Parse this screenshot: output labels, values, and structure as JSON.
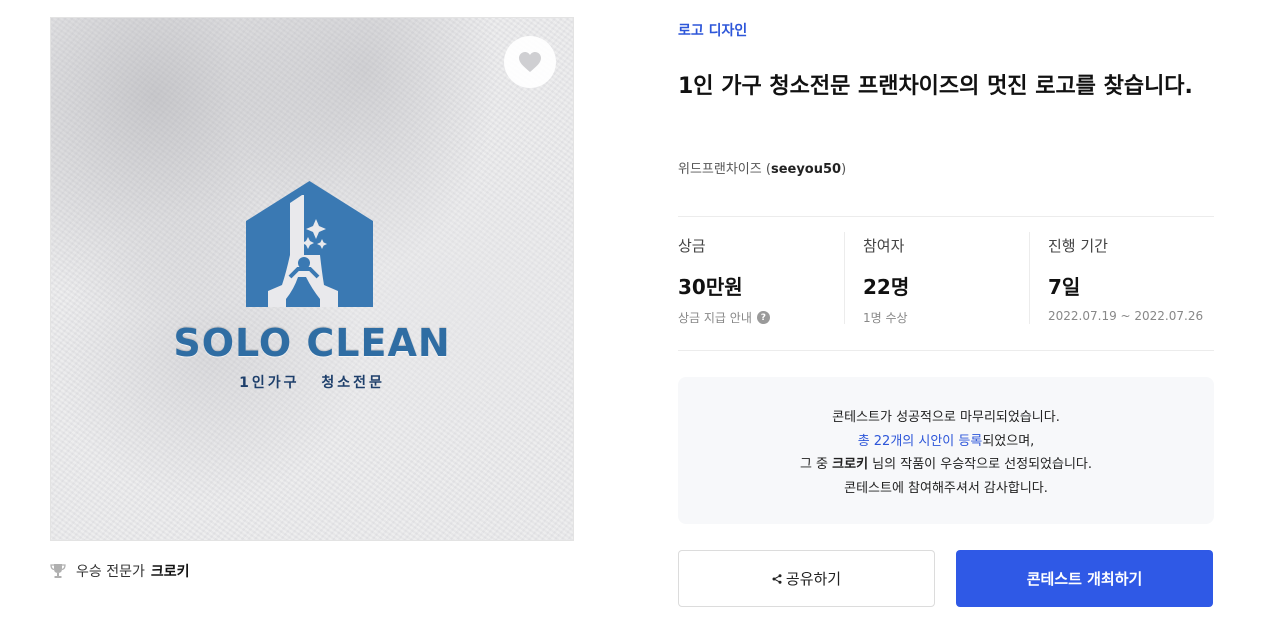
{
  "hero": {
    "logo_word": "SOLO CLEAN",
    "logo_sub": "1인가구 청소전문"
  },
  "winner": {
    "label": "우승 전문가",
    "name": "크로키"
  },
  "contest": {
    "category": "로고 디자인",
    "title": "1인 가구 청소전문 프랜차이즈의 멋진 로고를 찾습니다.",
    "owner_name": "위드프랜차이즈",
    "owner_id": "seeyou50"
  },
  "stats": {
    "prize": {
      "label": "상금",
      "value": "30만원",
      "sub": "상금 지급 안내"
    },
    "participants": {
      "label": "참여자",
      "value": "22명",
      "sub": "1명 수상"
    },
    "period": {
      "label": "진행 기간",
      "value": "7일",
      "sub": "2022.07.19 ~ 2022.07.26"
    }
  },
  "notice": {
    "line1": "콘테스트가 성공적으로 마무리되었습니다.",
    "line2_link": "총 22개의 시안이 등록",
    "line2_rest": "되었으며,",
    "line3_pre": "그 중 ",
    "line3_name": "크로키",
    "line3_post": " 님의 작품이 우승작으로 선정되었습니다.",
    "line4": "콘테스트에 참여해주셔서 감사합니다."
  },
  "buttons": {
    "share": "공유하기",
    "host": "콘테스트 개최하기"
  },
  "colors": {
    "accent": "#2f59e6",
    "link": "#2d56d9",
    "logo_blue": "#2f6da3"
  }
}
